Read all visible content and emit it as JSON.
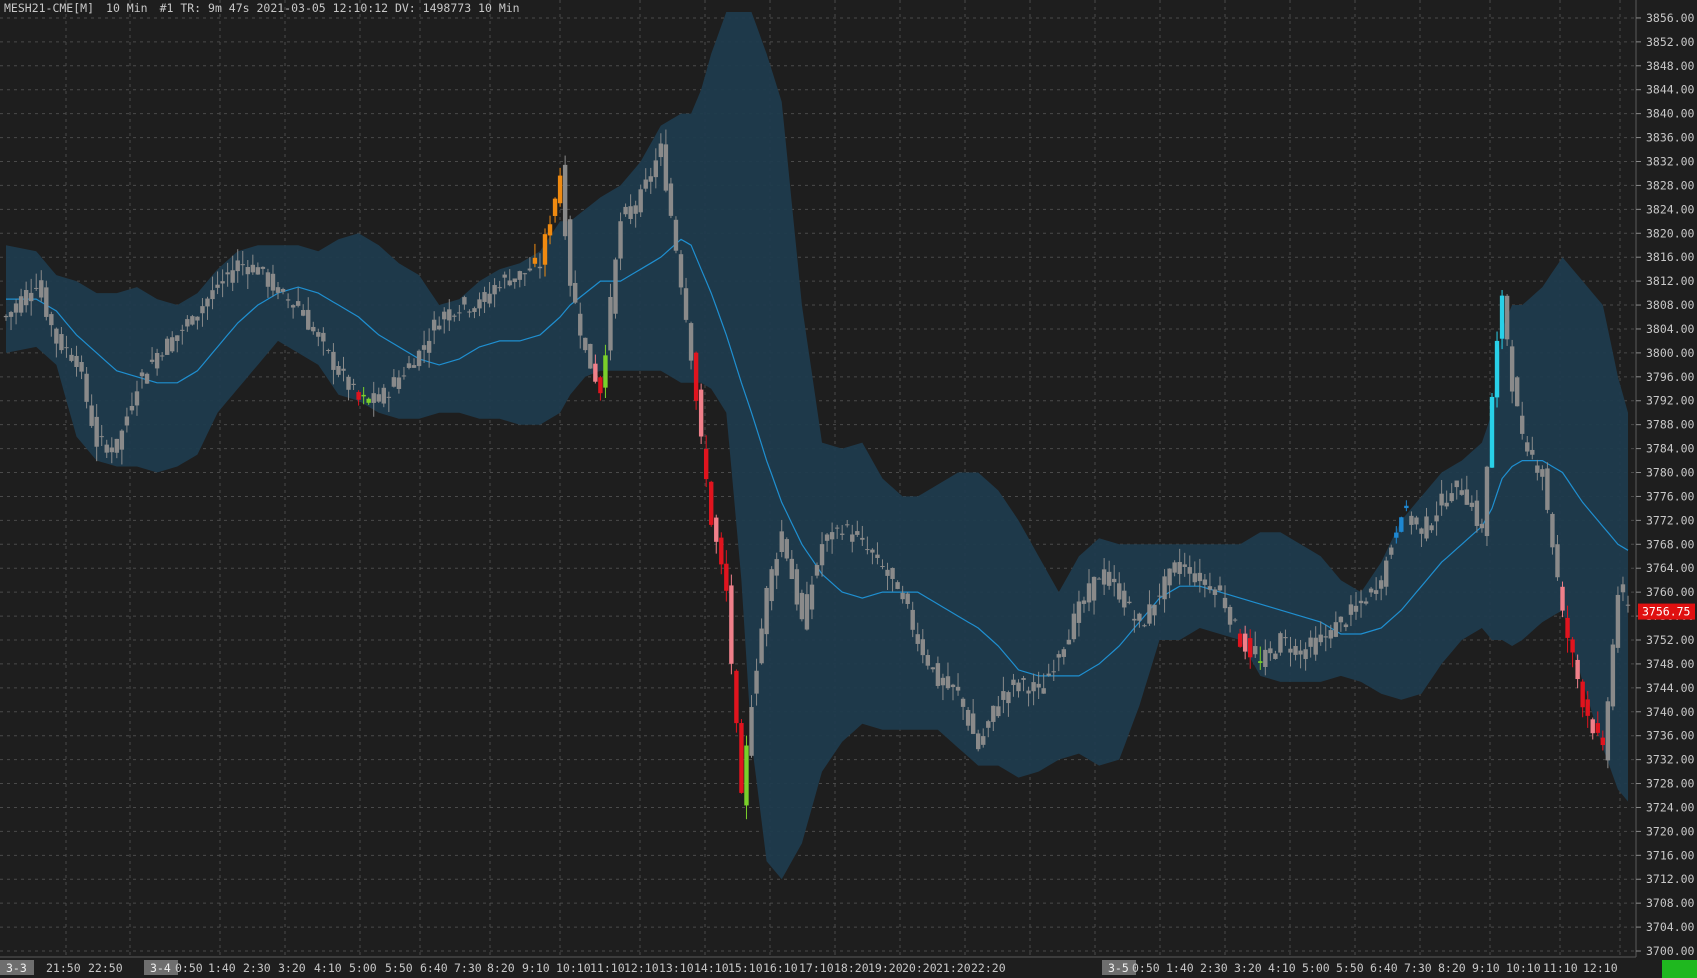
{
  "header": {
    "symbol": "MESH21-CME[M]",
    "interval": "10 Min",
    "info": "#1 TR: 9m 47s 2021-03-05 12:10:12 DV: 1498773 10 Min"
  },
  "status_box": "",
  "colors": {
    "background": "#1e1e1e",
    "grid": "#4a4a4a",
    "band_fill": "#1f3b4d",
    "midline": "#1f8fd0",
    "candle_neutral": "#8a8a8a",
    "up_strong_blue": "#1e88d2",
    "up_cyan": "#28d0e8",
    "up_orange": "#f08a10",
    "down_red": "#e0141e",
    "down_salmon": "#f0808a",
    "up_green": "#7ad02a",
    "last_price_bg": "#e01010",
    "axis_text": "#c8c8c8"
  },
  "chart_data": {
    "type": "candlestick",
    "price_axis": {
      "ticks": [
        "3856.00",
        "3852.00",
        "3848.00",
        "3844.00",
        "3840.00",
        "3836.00",
        "3832.00",
        "3828.00",
        "3824.00",
        "3820.00",
        "3816.00",
        "3812.00",
        "3808.00",
        "3804.00",
        "3800.00",
        "3796.00",
        "3792.00",
        "3788.00",
        "3784.00",
        "3780.00",
        "3776.00",
        "3772.00",
        "3768.00",
        "3764.00",
        "3760.00",
        "3756.00",
        "3752.00",
        "3748.00",
        "3744.00",
        "3740.00",
        "3736.00",
        "3732.00",
        "3728.00",
        "3724.00",
        "3720.00",
        "3716.00",
        "3712.00",
        "3708.00",
        "3704.00",
        "3700.00"
      ],
      "ymin": 3699.0,
      "ymax": 3859.0,
      "last_price": "3756.75"
    },
    "time_axis": {
      "day_markers": [
        "3-3",
        "3-4",
        "3-5"
      ],
      "labels_day1": [
        "21:50",
        "22:50"
      ],
      "labels_day2": [
        "0:50",
        "1:40",
        "2:30",
        "3:20",
        "4:10",
        "5:00",
        "5:50",
        "6:40",
        "7:30",
        "8:20",
        "9:10",
        "10:10",
        "11:10",
        "12:10",
        "13:10",
        "14:10",
        "15:10",
        "16:10",
        "17:10",
        "18:20",
        "19:20",
        "20:20",
        "21:20",
        "22:20"
      ],
      "labels_day3": [
        "0:50",
        "1:40",
        "2:30",
        "3:20",
        "4:10",
        "5:00",
        "5:50",
        "6:40",
        "7:30",
        "8:20",
        "9:10",
        "10:10",
        "11:10",
        "12:10"
      ]
    },
    "keyframes": [
      {
        "i": 0,
        "c": 3806,
        "u": 3818,
        "l": 3800,
        "m": 3809
      },
      {
        "i": 6,
        "c": 3812,
        "u": 3817,
        "l": 3801,
        "m": 3809
      },
      {
        "i": 10,
        "c": 3802,
        "u": 3813,
        "l": 3798,
        "m": 3807
      },
      {
        "i": 14,
        "c": 3799,
        "u": 3812,
        "l": 3786,
        "m": 3803
      },
      {
        "i": 18,
        "c": 3785,
        "u": 3810,
        "l": 3782,
        "m": 3800
      },
      {
        "i": 22,
        "c": 3784,
        "u": 3810,
        "l": 3781,
        "m": 3797
      },
      {
        "i": 26,
        "c": 3795,
        "u": 3811,
        "l": 3781,
        "m": 3796
      },
      {
        "i": 30,
        "c": 3800,
        "u": 3809,
        "l": 3780,
        "m": 3795
      },
      {
        "i": 34,
        "c": 3803,
        "u": 3808,
        "l": 3781,
        "m": 3795
      },
      {
        "i": 38,
        "c": 3807,
        "u": 3810,
        "l": 3783,
        "m": 3797
      },
      {
        "i": 42,
        "c": 3811,
        "u": 3814,
        "l": 3790,
        "m": 3801
      },
      {
        "i": 46,
        "c": 3815,
        "u": 3817,
        "l": 3794,
        "m": 3805
      },
      {
        "i": 50,
        "c": 3814,
        "u": 3818,
        "l": 3798,
        "m": 3808
      },
      {
        "i": 54,
        "c": 3810,
        "u": 3818,
        "l": 3802,
        "m": 3810
      },
      {
        "i": 58,
        "c": 3808,
        "u": 3818,
        "l": 3800,
        "m": 3811
      },
      {
        "i": 62,
        "c": 3802,
        "u": 3817,
        "l": 3798,
        "m": 3810
      },
      {
        "i": 66,
        "c": 3797,
        "u": 3819,
        "l": 3793,
        "m": 3808
      },
      {
        "i": 70,
        "c": 3792,
        "u": 3820,
        "l": 3792,
        "m": 3806
      },
      {
        "i": 74,
        "c": 3792,
        "u": 3818,
        "l": 3790,
        "m": 3803
      },
      {
        "i": 78,
        "c": 3796,
        "u": 3815,
        "l": 3789,
        "m": 3801
      },
      {
        "i": 82,
        "c": 3800,
        "u": 3813,
        "l": 3789,
        "m": 3799
      },
      {
        "i": 86,
        "c": 3806,
        "u": 3808,
        "l": 3790,
        "m": 3798
      },
      {
        "i": 90,
        "c": 3808,
        "u": 3809,
        "l": 3790,
        "m": 3799
      },
      {
        "i": 94,
        "c": 3808,
        "u": 3812,
        "l": 3789,
        "m": 3801
      },
      {
        "i": 98,
        "c": 3812,
        "u": 3814,
        "l": 3789,
        "m": 3802
      },
      {
        "i": 102,
        "c": 3813,
        "u": 3815,
        "l": 3788,
        "m": 3802
      },
      {
        "i": 106,
        "c": 3815,
        "u": 3817,
        "l": 3788,
        "m": 3803
      },
      {
        "i": 110,
        "c": 3830,
        "u": 3822,
        "l": 3790,
        "m": 3806
      },
      {
        "i": 112,
        "c": 3812,
        "u": 3822,
        "l": 3793,
        "m": 3808
      },
      {
        "i": 115,
        "c": 3800,
        "u": 3824,
        "l": 3796,
        "m": 3810
      },
      {
        "i": 118,
        "c": 3794,
        "u": 3826,
        "l": 3797,
        "m": 3812
      },
      {
        "i": 122,
        "c": 3822,
        "u": 3828,
        "l": 3797,
        "m": 3812
      },
      {
        "i": 126,
        "c": 3826,
        "u": 3832,
        "l": 3797,
        "m": 3814
      },
      {
        "i": 130,
        "c": 3834,
        "u": 3838,
        "l": 3797,
        "m": 3816
      },
      {
        "i": 134,
        "c": 3812,
        "u": 3840,
        "l": 3795,
        "m": 3819
      },
      {
        "i": 136,
        "c": 3800,
        "u": 3840,
        "l": 3795,
        "m": 3818
      },
      {
        "i": 138,
        "c": 3785,
        "u": 3844,
        "l": 3795,
        "m": 3814
      },
      {
        "i": 140,
        "c": 3772,
        "u": 3850,
        "l": 3794,
        "m": 3810
      },
      {
        "i": 143,
        "c": 3760,
        "u": 3857,
        "l": 3790,
        "m": 3803
      },
      {
        "i": 146,
        "c": 3725,
        "u": 3857,
        "l": 3762,
        "m": 3795
      },
      {
        "i": 148,
        "c": 3742,
        "u": 3857,
        "l": 3735,
        "m": 3790
      },
      {
        "i": 151,
        "c": 3760,
        "u": 3850,
        "l": 3715,
        "m": 3782
      },
      {
        "i": 154,
        "c": 3770,
        "u": 3842,
        "l": 3712,
        "m": 3775
      },
      {
        "i": 158,
        "c": 3755,
        "u": 3808,
        "l": 3718,
        "m": 3768
      },
      {
        "i": 162,
        "c": 3768,
        "u": 3785,
        "l": 3730,
        "m": 3763
      },
      {
        "i": 166,
        "c": 3771,
        "u": 3784,
        "l": 3735,
        "m": 3760
      },
      {
        "i": 170,
        "c": 3768,
        "u": 3785,
        "l": 3738,
        "m": 3759
      },
      {
        "i": 174,
        "c": 3764,
        "u": 3779,
        "l": 3737,
        "m": 3760
      },
      {
        "i": 178,
        "c": 3759,
        "u": 3776,
        "l": 3737,
        "m": 3760
      },
      {
        "i": 181,
        "c": 3752,
        "u": 3776,
        "l": 3737,
        "m": 3760
      },
      {
        "i": 185,
        "c": 3745,
        "u": 3778,
        "l": 3737,
        "m": 3758
      },
      {
        "i": 189,
        "c": 3743,
        "u": 3780,
        "l": 3734,
        "m": 3756
      },
      {
        "i": 193,
        "c": 3734,
        "u": 3780,
        "l": 3731,
        "m": 3754
      },
      {
        "i": 197,
        "c": 3742,
        "u": 3777,
        "l": 3731,
        "m": 3751
      },
      {
        "i": 201,
        "c": 3745,
        "u": 3772,
        "l": 3729,
        "m": 3747
      },
      {
        "i": 205,
        "c": 3743,
        "u": 3766,
        "l": 3730,
        "m": 3746
      },
      {
        "i": 209,
        "c": 3750,
        "u": 3760,
        "l": 3732,
        "m": 3746
      },
      {
        "i": 213,
        "c": 3757,
        "u": 3766,
        "l": 3733,
        "m": 3746
      },
      {
        "i": 217,
        "c": 3763,
        "u": 3769,
        "l": 3731,
        "m": 3748
      },
      {
        "i": 221,
        "c": 3760,
        "u": 3768,
        "l": 3732,
        "m": 3751
      },
      {
        "i": 225,
        "c": 3754,
        "u": 3768,
        "l": 3741,
        "m": 3755
      },
      {
        "i": 229,
        "c": 3760,
        "u": 3768,
        "l": 3752,
        "m": 3759
      },
      {
        "i": 233,
        "c": 3765,
        "u": 3768,
        "l": 3752,
        "m": 3761
      },
      {
        "i": 237,
        "c": 3762,
        "u": 3768,
        "l": 3754,
        "m": 3761
      },
      {
        "i": 241,
        "c": 3760,
        "u": 3768,
        "l": 3753,
        "m": 3760
      },
      {
        "i": 245,
        "c": 3752,
        "u": 3768,
        "l": 3752,
        "m": 3759
      },
      {
        "i": 249,
        "c": 3748,
        "u": 3770,
        "l": 3746,
        "m": 3758
      },
      {
        "i": 253,
        "c": 3752,
        "u": 3770,
        "l": 3745,
        "m": 3757
      },
      {
        "i": 257,
        "c": 3750,
        "u": 3768,
        "l": 3745,
        "m": 3756
      },
      {
        "i": 261,
        "c": 3752,
        "u": 3766,
        "l": 3745,
        "m": 3755
      },
      {
        "i": 265,
        "c": 3755,
        "u": 3762,
        "l": 3746,
        "m": 3753
      },
      {
        "i": 269,
        "c": 3758,
        "u": 3760,
        "l": 3745,
        "m": 3753
      },
      {
        "i": 273,
        "c": 3762,
        "u": 3765,
        "l": 3743,
        "m": 3754
      },
      {
        "i": 277,
        "c": 3774,
        "u": 3772,
        "l": 3742,
        "m": 3757
      },
      {
        "i": 281,
        "c": 3770,
        "u": 3776,
        "l": 3743,
        "m": 3761
      },
      {
        "i": 285,
        "c": 3775,
        "u": 3780,
        "l": 3748,
        "m": 3765
      },
      {
        "i": 289,
        "c": 3778,
        "u": 3782,
        "l": 3752,
        "m": 3768
      },
      {
        "i": 293,
        "c": 3770,
        "u": 3785,
        "l": 3754,
        "m": 3771
      },
      {
        "i": 295,
        "c": 3792,
        "u": 3790,
        "l": 3752,
        "m": 3774
      },
      {
        "i": 297,
        "c": 3810,
        "u": 3804,
        "l": 3752,
        "m": 3779
      },
      {
        "i": 299,
        "c": 3795,
        "u": 3808,
        "l": 3751,
        "m": 3781
      },
      {
        "i": 301,
        "c": 3785,
        "u": 3808,
        "l": 3752,
        "m": 3782
      },
      {
        "i": 305,
        "c": 3780,
        "u": 3811,
        "l": 3755,
        "m": 3782
      },
      {
        "i": 309,
        "c": 3756,
        "u": 3816,
        "l": 3757,
        "m": 3780
      },
      {
        "i": 313,
        "c": 3742,
        "u": 3812,
        "l": 3745,
        "m": 3775
      },
      {
        "i": 317,
        "c": 3733,
        "u": 3808,
        "l": 3734,
        "m": 3771
      },
      {
        "i": 320,
        "c": 3760,
        "u": 3796,
        "l": 3727,
        "m": 3768
      },
      {
        "i": 322,
        "c": 3757,
        "u": 3790,
        "l": 3725,
        "m": 3767
      }
    ]
  }
}
